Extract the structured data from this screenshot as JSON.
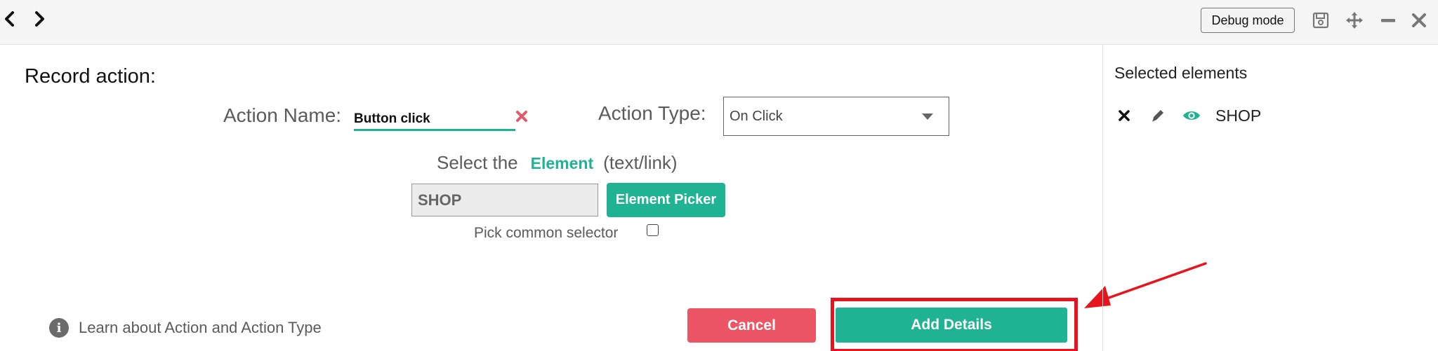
{
  "toolbar": {
    "debug_label": "Debug mode",
    "icons": [
      "chevron-left-icon",
      "chevron-right-icon",
      "save-icon",
      "move-icon",
      "minimize-icon",
      "close-icon"
    ]
  },
  "form": {
    "title": "Record action:",
    "action_name_label": "Action Name:",
    "action_name_value": "Button click",
    "action_type_label": "Action Type:",
    "action_type_value": "On Click",
    "select_prefix": "Select the",
    "select_element_word": "Element",
    "select_suffix": "(text/link)",
    "element_value": "SHOP",
    "picker_label": "Element Picker",
    "common_selector_label": "Pick common selector",
    "common_selector_checked": false
  },
  "footer": {
    "learn_label": "Learn about Action and Action Type",
    "cancel_label": "Cancel",
    "add_label": "Add Details"
  },
  "side": {
    "title": "Selected elements",
    "items": [
      {
        "label": "SHOP"
      }
    ]
  },
  "colors": {
    "accent": "#1fb394",
    "danger": "#ec5565",
    "highlight": "#e8141d",
    "clear_x": "#e05a6a"
  }
}
